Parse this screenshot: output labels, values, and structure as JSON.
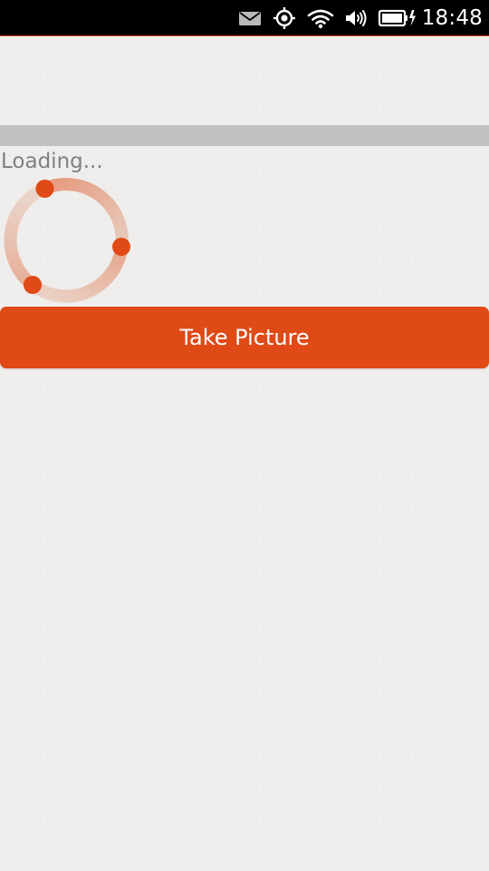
{
  "status_bar": {
    "time": "18:48",
    "icons": [
      "mail-icon",
      "location-icon",
      "wifi-icon",
      "volume-icon",
      "battery-charging-icon"
    ]
  },
  "loading": {
    "label": "Loading..."
  },
  "actions": {
    "take_picture_label": "Take Picture"
  },
  "colors": {
    "accent": "#df4a16",
    "status_bar_bg": "#000000",
    "page_bg": "#efeeec",
    "separator_bar": "#c2c2c2",
    "loading_text": "#808080"
  }
}
